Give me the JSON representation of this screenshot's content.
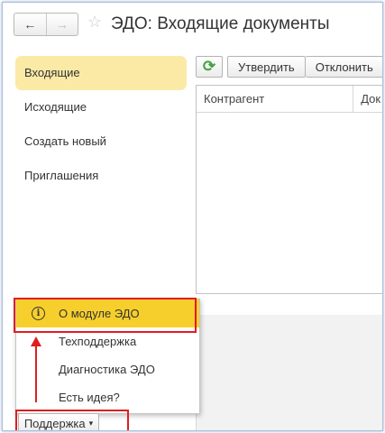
{
  "header": {
    "back_icon": "←",
    "forward_icon": "→",
    "star_icon": "☆",
    "title": "ЭДО: Входящие документы"
  },
  "sidebar": {
    "items": [
      {
        "label": "Входящие",
        "active": true
      },
      {
        "label": "Исходящие",
        "active": false
      },
      {
        "label": "Создать новый",
        "active": false
      },
      {
        "label": "Приглашения",
        "active": false
      }
    ]
  },
  "toolbar": {
    "refresh_icon": "⟳",
    "approve_label": "Утвердить",
    "reject_label": "Отклонить"
  },
  "table": {
    "columns": [
      "Контрагент",
      "Док"
    ]
  },
  "popup": {
    "info_icon": "i",
    "items": [
      "О модуле ЭДО",
      "Техподдержка",
      "Диагностика ЭДО",
      "Есть идея?"
    ]
  },
  "footer": {
    "support_label": "Поддержка",
    "caret": "▾"
  },
  "colors": {
    "active_item_bg": "#fbe9a6",
    "popup_highlight": "#f7cf2c",
    "annotation_red": "#e01e1e",
    "refresh_green": "#3fa33f"
  }
}
